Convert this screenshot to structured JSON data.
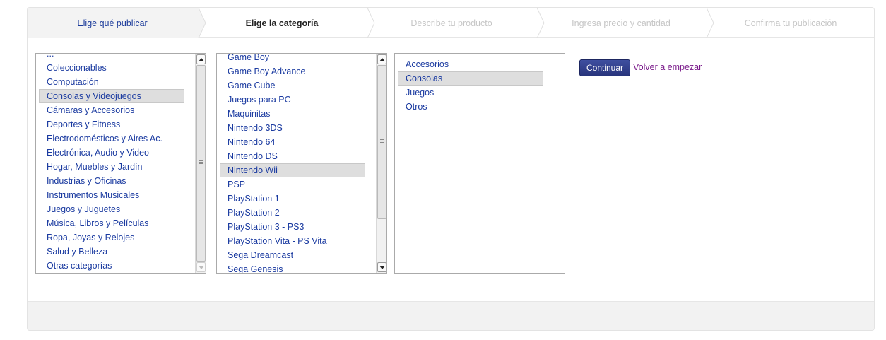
{
  "steps": [
    {
      "label": "Elige qué publicar",
      "state": "done"
    },
    {
      "label": "Elige la categoría",
      "state": "current"
    },
    {
      "label": "Describe tu producto",
      "state": "pending"
    },
    {
      "label": "Ingresa precio y cantidad",
      "state": "pending"
    },
    {
      "label": "Confirma tu publicación",
      "state": "pending"
    }
  ],
  "category_list": {
    "partial_top_item": "...",
    "items": [
      "Coleccionables",
      "Computación",
      "Consolas y Videojuegos",
      "Cámaras y Accesorios",
      "Deportes y Fitness",
      "Electrodomésticos y Aires Ac.",
      "Electrónica, Audio y Video",
      "Hogar, Muebles y Jardín",
      "Industrias y Oficinas",
      "Instrumentos Musicales",
      "Juegos y Juguetes",
      "Música, Libros y Películas",
      "Ropa, Joyas y Relojes",
      "Salud y Belleza",
      "Otras categorías"
    ],
    "selected": "Consolas y Videojuegos"
  },
  "platform_list": {
    "items": [
      "Game Boy",
      "Game Boy Advance",
      "Game Cube",
      "Juegos para PC",
      "Maquinitas",
      "Nintendo 3DS",
      "Nintendo 64",
      "Nintendo DS",
      "Nintendo Wii",
      "PSP",
      "PlayStation 1",
      "PlayStation 2",
      "PlayStation 3 - PS3",
      "PlayStation Vita - PS Vita",
      "Sega Dreamcast",
      "Sega Genesis"
    ],
    "selected": "Nintendo Wii"
  },
  "subcategory_list": {
    "items": [
      "Accesorios",
      "Consolas",
      "Juegos",
      "Otros"
    ],
    "selected": "Consolas"
  },
  "actions": {
    "continue_label": "Continuar",
    "restart_label": "Volver a empezar"
  },
  "colors": {
    "link": "#1a3aa0",
    "button": "#2e3a86",
    "restart_link": "#7a1a8a",
    "selected_bg": "#dedede"
  }
}
